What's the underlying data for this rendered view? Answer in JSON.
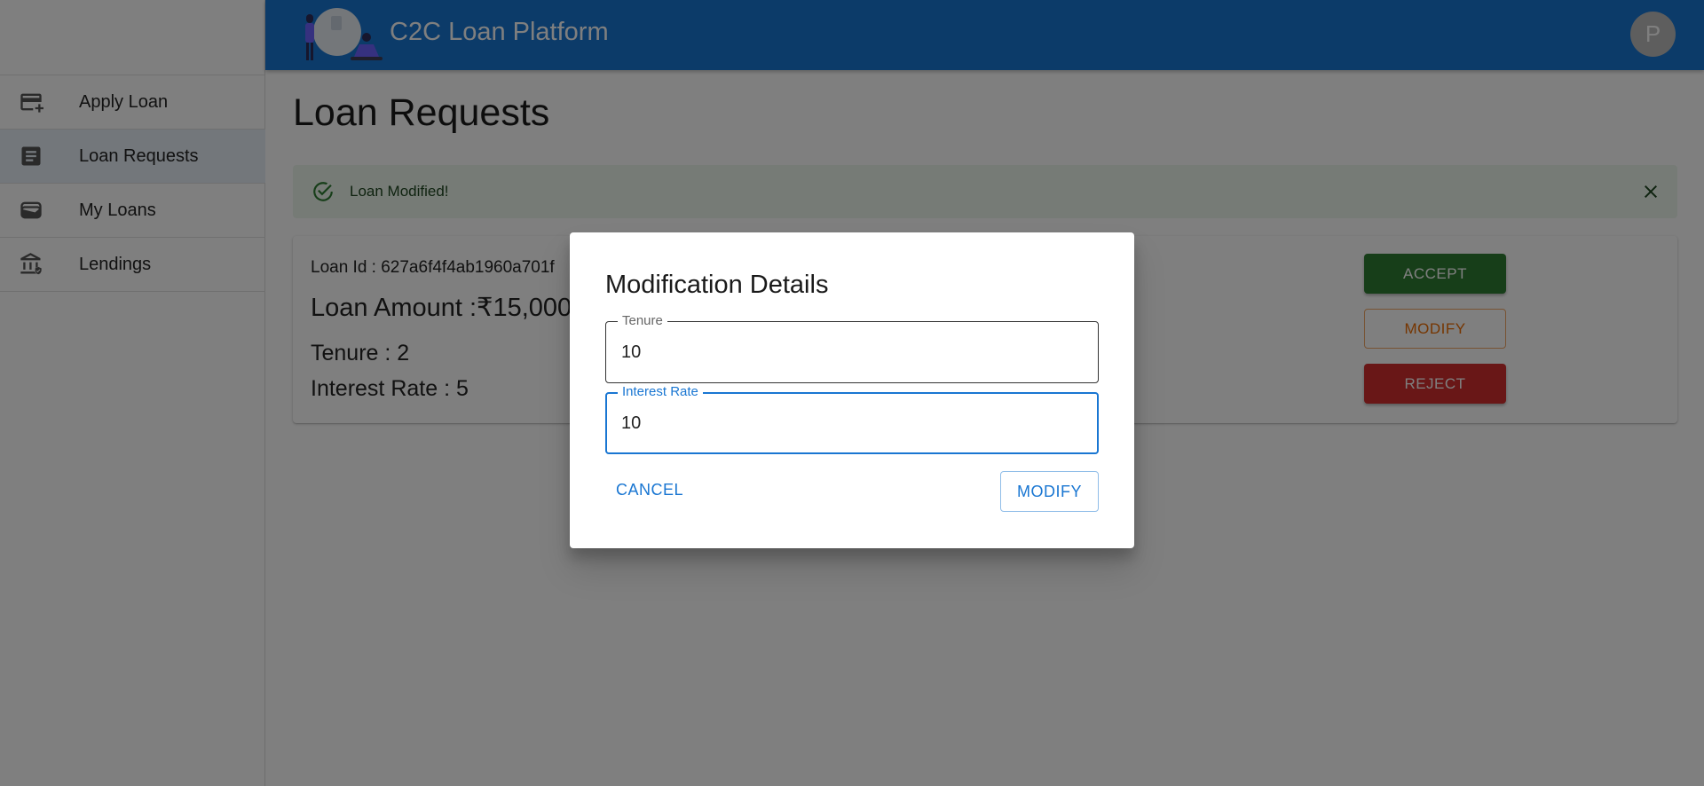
{
  "app": {
    "brand": "C2C Loan Platform",
    "avatar_initial": "P"
  },
  "sidebar": {
    "items": [
      {
        "label": "Apply Loan",
        "icon": "credit-card-add-icon"
      },
      {
        "label": "Loan Requests",
        "icon": "document-icon",
        "active": true
      },
      {
        "label": "My Loans",
        "icon": "wallet-icon"
      },
      {
        "label": "Lendings",
        "icon": "bank-icon"
      }
    ]
  },
  "main": {
    "title": "Loan Requests",
    "alert": {
      "text": "Loan Modified!",
      "icon": "check-circle-icon",
      "severity": "success"
    },
    "loan": {
      "id_text": "Loan Id : 627a6f4f4ab1960a701f",
      "amount_text": "Loan Amount :₹15,000",
      "tenure_text": "Tenure : 2",
      "rate_text": "Interest Rate : 5"
    },
    "actions": {
      "accept": "ACCEPT",
      "modify": "MODIFY",
      "reject": "REJECT"
    }
  },
  "dialog": {
    "title": "Modification Details",
    "tenure_label": "Tenure",
    "tenure_value": "10",
    "rate_label": "Interest Rate",
    "rate_value": "10",
    "cancel": "CANCEL",
    "modify": "MODIFY"
  },
  "colors": {
    "primary": "#1976d2",
    "success": "#2e7d32",
    "warning": "#ed6c02",
    "error": "#d32f2f"
  }
}
